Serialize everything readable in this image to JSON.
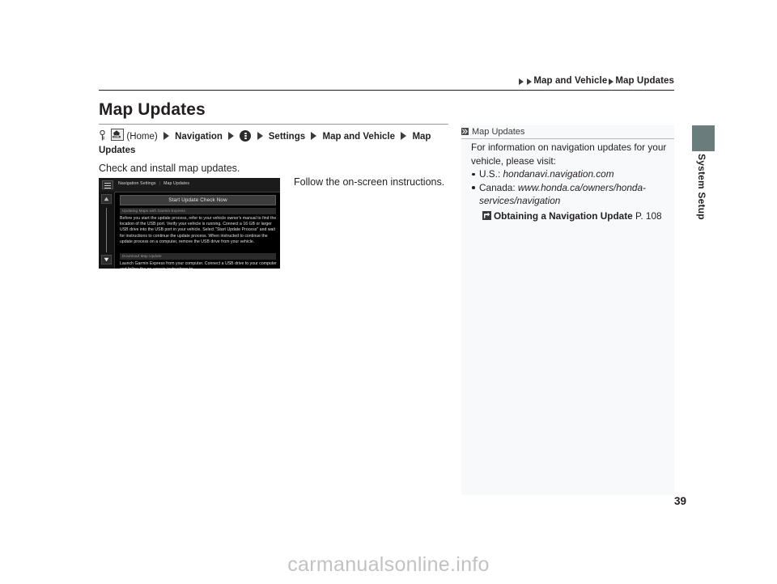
{
  "header": {
    "breadcrumb": [
      "Map and Vehicle",
      "Map Updates"
    ]
  },
  "page": {
    "title": "Map Updates",
    "number": "39",
    "section_tab": "System Setup"
  },
  "nav_path": {
    "key_icon": "key-icon",
    "home_icon": "home-icon",
    "home_label": "(Home)",
    "item1": "Navigation",
    "dots_icon": "vertical-dots-icon",
    "item2": "Settings",
    "item3": "Map and Vehicle",
    "item4": "Map Updates"
  },
  "body": {
    "intro": "Check and install map updates.",
    "instruction": "Follow the on-screen instructions."
  },
  "nav_screen": {
    "hamburger_icon": "hamburger-menu-icon",
    "crumb1": "Navigation Settings",
    "crumb_sep": "|",
    "crumb2": "Map Updates",
    "scroll_up_icon": "scroll-up-icon",
    "scroll_down_icon": "scroll-down-icon",
    "primary_button": "Start Update Check Now",
    "section1_title": "Updating Maps with Garmin Express",
    "section1_body": "Before you start the update process, refer to your vehicle owner's manual to find the location of the USB port. Verify your vehicle is running. Connect a 16 GB or larger USB drive into the USB port in your vehicle. Select \"Start Update Process\" and wait for instructions to continue the update process. When instructed to continue the update process on a computer, remove the USB drive from your vehicle.",
    "section2_title": "Download Map Update",
    "section2_body": "Launch Garmin Express from your computer. Connect a USB drive to your computer and follow the on-screen instructions to"
  },
  "side_note": {
    "chevron_icon": "double-chevron-icon",
    "title": "Map Updates",
    "intro_line1": "For information on navigation updates for your",
    "intro_line2": "vehicle, please visit:",
    "bullets": [
      {
        "label": "U.S.: ",
        "value": "hondanavi.navigation.com"
      },
      {
        "label": "Canada: ",
        "value": "www.honda.ca/owners/honda-services/navigation"
      }
    ],
    "ref_icon": "page-reference-arrow-icon",
    "ref_title": "Obtaining a Navigation Update",
    "ref_page": "P. 108"
  },
  "watermark": "carmanualsonline.info",
  "colors": {
    "accent_tab": "#6b7c7c",
    "panel_bg": "#f8f9fa",
    "text": "#231f20",
    "screen_bg": "#000000"
  }
}
